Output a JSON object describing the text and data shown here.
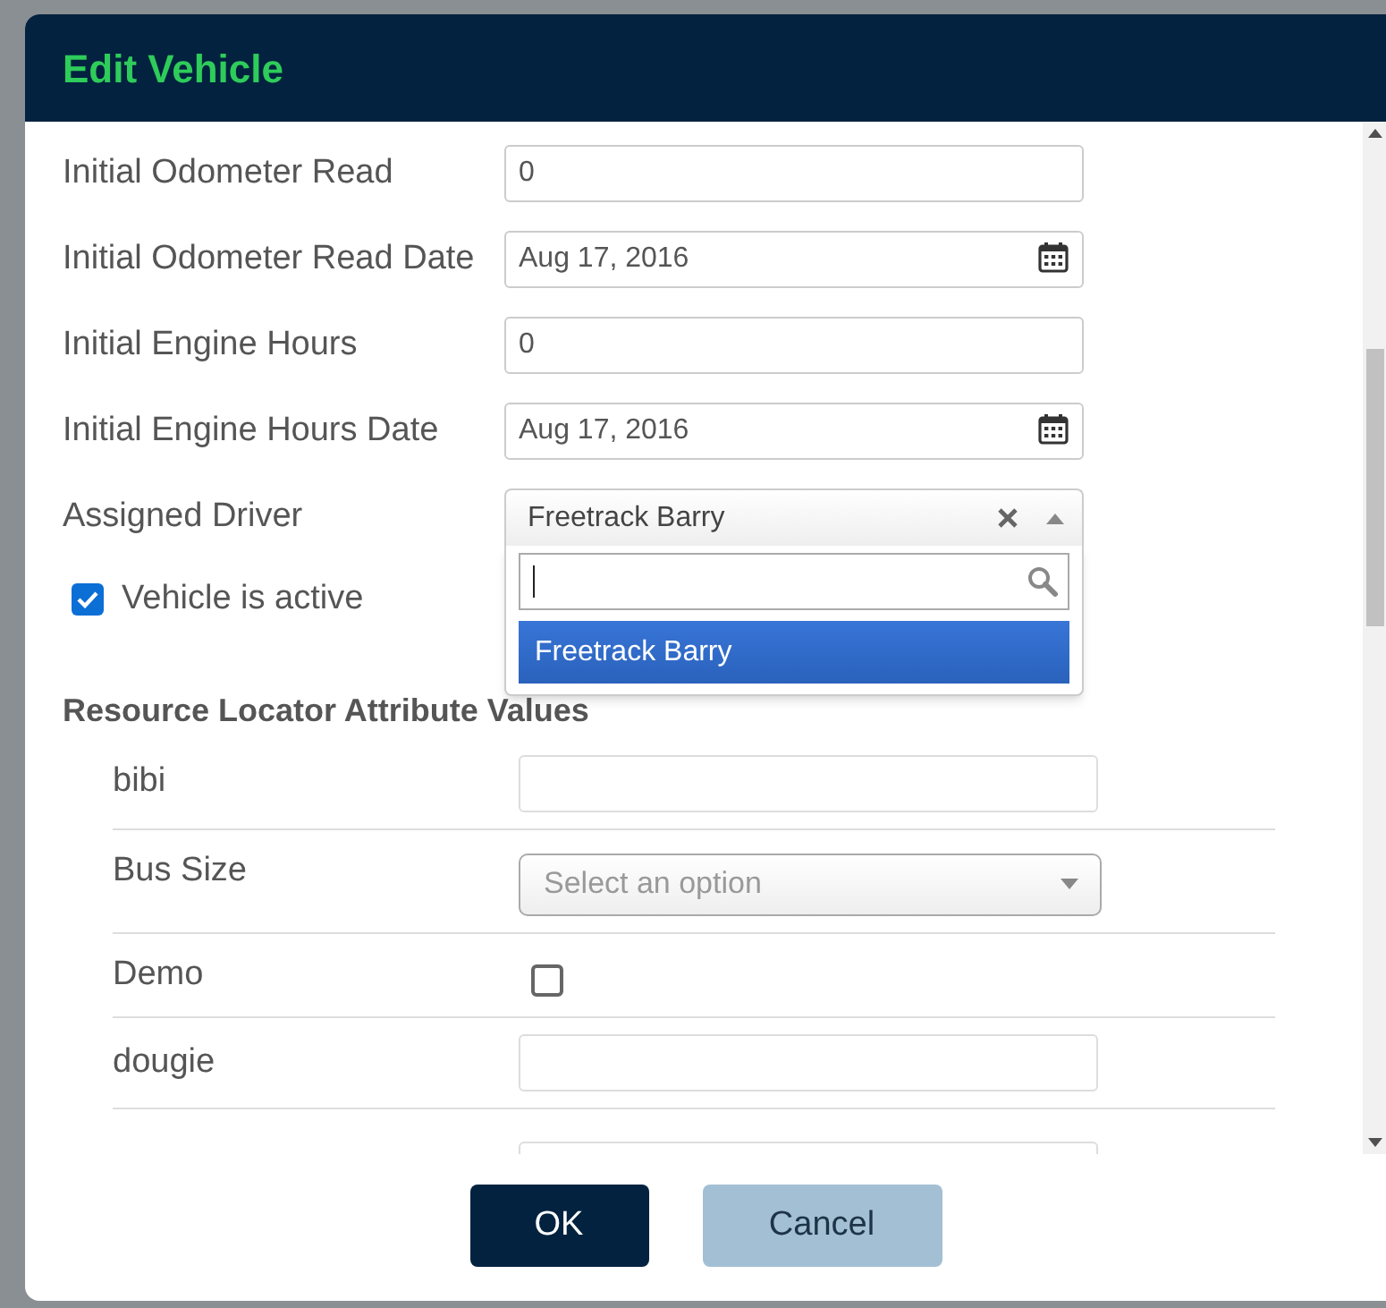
{
  "dialog": {
    "title": "Edit Vehicle"
  },
  "fields": [
    {
      "label": "Initial Odometer Read",
      "kind": "text",
      "value": "0"
    },
    {
      "label": "Initial Odometer Read Date",
      "kind": "date",
      "value": "Aug 17, 2016"
    },
    {
      "label": "Initial Engine Hours",
      "kind": "text",
      "value": "0"
    },
    {
      "label": "Initial Engine Hours Date",
      "kind": "date",
      "value": "Aug 17, 2016"
    },
    {
      "label": "Assigned Driver",
      "kind": "select",
      "value": "Freetrack Barry",
      "expanded": true,
      "options": [
        {
          "label": "Freetrack Barry",
          "selected": true
        }
      ]
    }
  ],
  "active": {
    "label": "Vehicle is active",
    "checked": true
  },
  "attributes": {
    "heading": "Resource Locator Attribute Values",
    "rows": [
      {
        "label": "bibi",
        "kind": "text"
      },
      {
        "label": "Bus Size",
        "kind": "select",
        "placeholder": "Select an option"
      },
      {
        "label": "Demo",
        "kind": "checkbox",
        "checked": false
      },
      {
        "label": "dougie",
        "kind": "text"
      },
      {
        "kind": "text"
      }
    ]
  },
  "buttons": [
    {
      "label": "OK",
      "kind": "primary"
    },
    {
      "label": "Cancel",
      "kind": "secondary"
    }
  ]
}
